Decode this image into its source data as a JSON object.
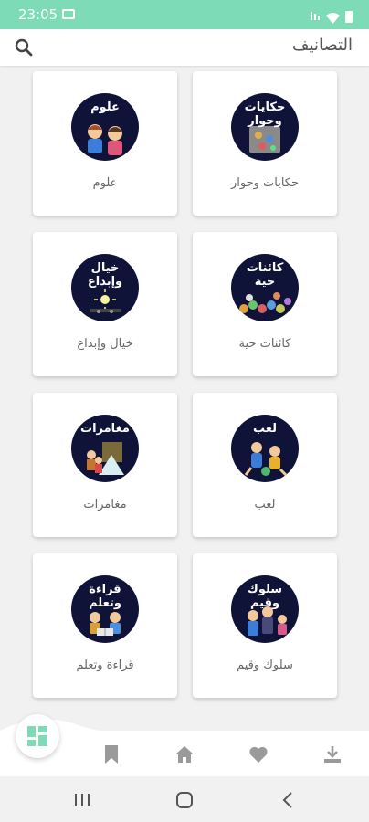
{
  "status_bar": {
    "time": "23:05"
  },
  "app_bar": {
    "title": "التصانيف"
  },
  "colors": {
    "accent": "#7ddcb7",
    "nav_icon": "#9a9a9a",
    "thumb_bg": "#101338"
  },
  "categories": [
    {
      "label": "حكايات وحوار",
      "thumb_text": "حكايات\nوحوار"
    },
    {
      "label": "علوم",
      "thumb_text": "علوم"
    },
    {
      "label": "كائنات حية",
      "thumb_text": "كائنات\nحية"
    },
    {
      "label": "خيال وإبداع",
      "thumb_text": "خيال\nوإبداع"
    },
    {
      "label": "لعب",
      "thumb_text": "لعب"
    },
    {
      "label": "مغامرات",
      "thumb_text": "مغامرات"
    },
    {
      "label": "سلوك وقيم",
      "thumb_text": "سلوك\nوقيم"
    },
    {
      "label": "قراءة وتعلم",
      "thumb_text": "قراءة\nوتعلم"
    }
  ],
  "bottom_nav": {
    "items": [
      "categories-icon",
      "bookmark-icon",
      "home-icon",
      "heart-icon",
      "download-icon"
    ]
  }
}
